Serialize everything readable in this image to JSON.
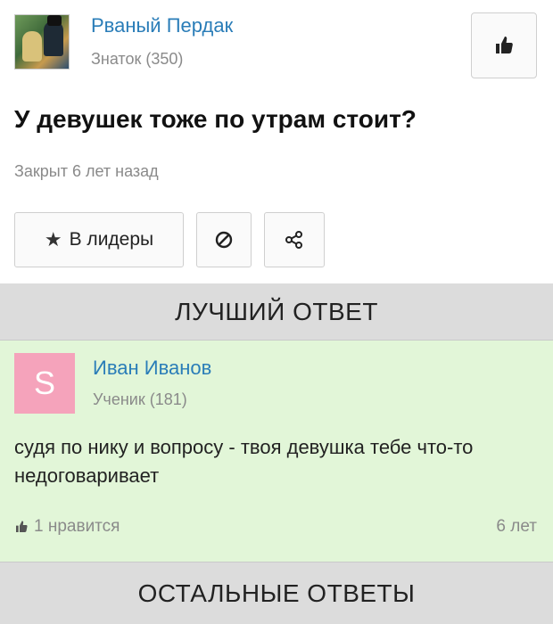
{
  "question": {
    "author_name": "Рваный Пердак",
    "author_rank": "Знаток (350)",
    "title": "У девушек тоже по утрам стоит?",
    "status": "Закрыт 6 лет назад",
    "actions": {
      "leaders_label": "В лидеры",
      "leaders_icon": "star-icon",
      "block_icon": "block-icon",
      "share_icon": "share-icon"
    },
    "like_icon": "thumbs-up-icon"
  },
  "best_answer_header": "ЛУЧШИЙ ОТВЕТ",
  "best_answer": {
    "avatar_letter": "S",
    "author_name": "Иван Иванов",
    "author_rank": "Ученик (181)",
    "text": "судя по нику и вопросу - твоя девушка тебе что-то недоговаривает",
    "likes": "1 нравится",
    "age": "6 лет"
  },
  "other_answers_header": "ОСТАЛЬНЫЕ ОТВЕТЫ",
  "colors": {
    "link_blue": "#2a7db8",
    "best_answer_bg": "#e2f6d8",
    "header_gray": "#dcdcdc",
    "avatar_pink": "#f5a3bb"
  }
}
